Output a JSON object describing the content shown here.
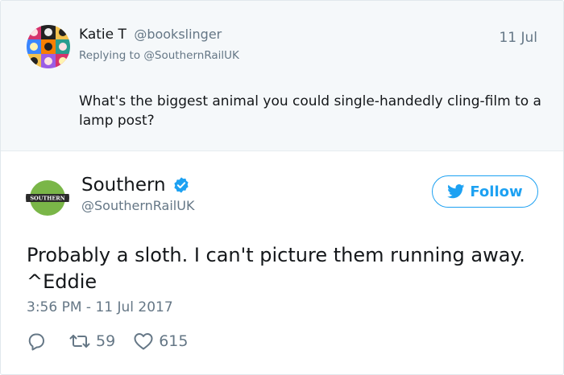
{
  "reply": {
    "name": "Katie T",
    "handle": "@bookslinger",
    "date": "11 Jul",
    "replying_prefix": "Replying to",
    "replying_mention": "@SouthernRailUK",
    "text": "What's the biggest animal you could single-handedly cling-film to a lamp post?"
  },
  "tweet": {
    "name": "Southern",
    "handle": "@SouthernRailUK",
    "verified_icon": "verified-badge-icon",
    "avatar_logo_text": "SOUTHERN",
    "follow_label": "Follow",
    "text_line1": "Probably a sloth. I can't picture them running away.",
    "text_line2": "^Eddie",
    "timestamp": "3:56 PM - 11 Jul 2017",
    "retweet_count": "59",
    "like_count": "615"
  },
  "colors": {
    "accent": "#1da1f2",
    "muted": "#657786",
    "reply_bg": "#f5f8fa",
    "southern_green": "#7ab648"
  }
}
